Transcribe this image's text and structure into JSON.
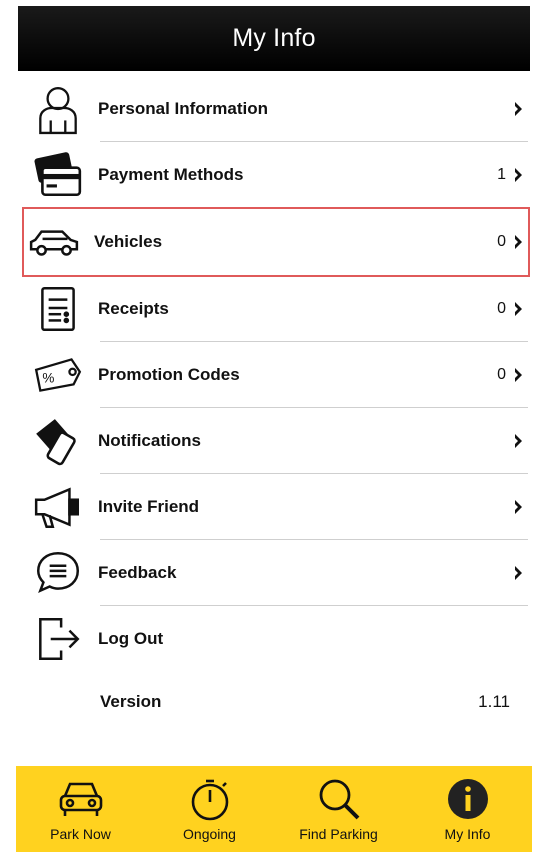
{
  "header": {
    "title": "My Info"
  },
  "menu": {
    "items": [
      {
        "label": "Personal Information",
        "count": "",
        "icon": "person-icon"
      },
      {
        "label": "Payment Methods",
        "count": "1",
        "icon": "cards-icon"
      },
      {
        "label": "Vehicles",
        "count": "0",
        "icon": "car-icon",
        "highlighted": true
      },
      {
        "label": "Receipts",
        "count": "0",
        "icon": "receipt-icon"
      },
      {
        "label": "Promotion Codes",
        "count": "0",
        "icon": "tag-icon"
      },
      {
        "label": "Notifications",
        "count": "",
        "icon": "notifications-icon"
      },
      {
        "label": "Invite Friend",
        "count": "",
        "icon": "megaphone-icon"
      },
      {
        "label": "Feedback",
        "count": "",
        "icon": "chat-icon"
      },
      {
        "label": "Log Out",
        "count": "",
        "icon": "logout-icon"
      }
    ]
  },
  "version": {
    "label": "Version",
    "value": "1.11"
  },
  "tabbar": {
    "tabs": [
      {
        "label": "Park Now",
        "icon": "car-front-icon"
      },
      {
        "label": "Ongoing",
        "icon": "stopwatch-icon"
      },
      {
        "label": "Find Parking",
        "icon": "search-icon"
      },
      {
        "label": "My Info",
        "icon": "info-icon",
        "active": true
      }
    ]
  },
  "colors": {
    "header_bg": "#000000",
    "tabbar_bg": "#ffd21f",
    "highlight": "#e05a5a"
  }
}
